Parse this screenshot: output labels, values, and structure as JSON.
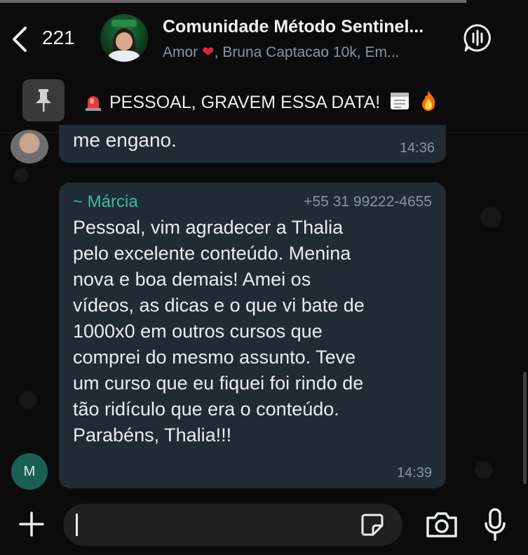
{
  "header": {
    "back_count": "221",
    "title": "Comunidade Método Sentinel...",
    "subtitle_before_heart": "Amor",
    "subtitle_after_heart": ", Bruna Captacao 10k, Em..."
  },
  "pinned": {
    "text": "PESSOAL, GRAVEM ESSA DATA!"
  },
  "messages": [
    {
      "text": "me engano.",
      "time": "14:36"
    },
    {
      "sender": "~ Márcia",
      "phone": "+55 31 99222-4655",
      "text": "Pessoal, vim agradecer a Thalia\npelo excelente conteúdo. Menina\nnova e boa demais! Amei os\nvídeos, as dicas e o que vi bate de\n1000x0 em outros cursos que\ncomprei do mesmo assunto. Teve\num curso que eu fiquei foi rindo de\ntão ridículo que era o conteúdo.\nParabéns, Thalia!!!",
      "time": "14:39",
      "avatar_initial": "M"
    }
  ],
  "colors": {
    "background": "#0b0b0b",
    "bubble": "#202c33",
    "sender": "#3fb9a6",
    "muted": "#8696a0"
  }
}
